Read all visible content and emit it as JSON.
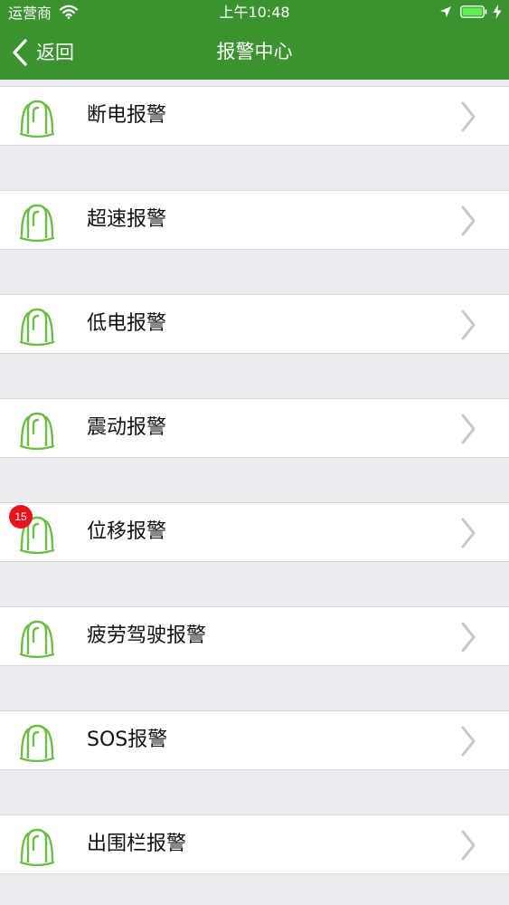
{
  "status_bar": {
    "carrier": "运营商",
    "time": "上午10:48"
  },
  "nav": {
    "back_label": "返回",
    "title": "报警中心"
  },
  "colors": {
    "nav_background": "#3a932f",
    "icon_green": "#6cbd45",
    "badge_red": "#e5151b",
    "list_background": "#ebebf0"
  },
  "alarms": [
    {
      "label": "断电报警",
      "icon": "alarm-light-icon"
    },
    {
      "label": "超速报警",
      "icon": "alarm-light-icon"
    },
    {
      "label": "低电报警",
      "icon": "alarm-light-icon"
    },
    {
      "label": "震动报警",
      "icon": "alarm-light-icon"
    },
    {
      "label": "位移报警",
      "icon": "alarm-light-icon",
      "badge": "15"
    },
    {
      "label": "疲劳驾驶报警",
      "icon": "alarm-light-icon"
    },
    {
      "label": "SOS报警",
      "icon": "alarm-light-icon"
    },
    {
      "label": "出围栏报警",
      "icon": "alarm-light-icon"
    }
  ]
}
